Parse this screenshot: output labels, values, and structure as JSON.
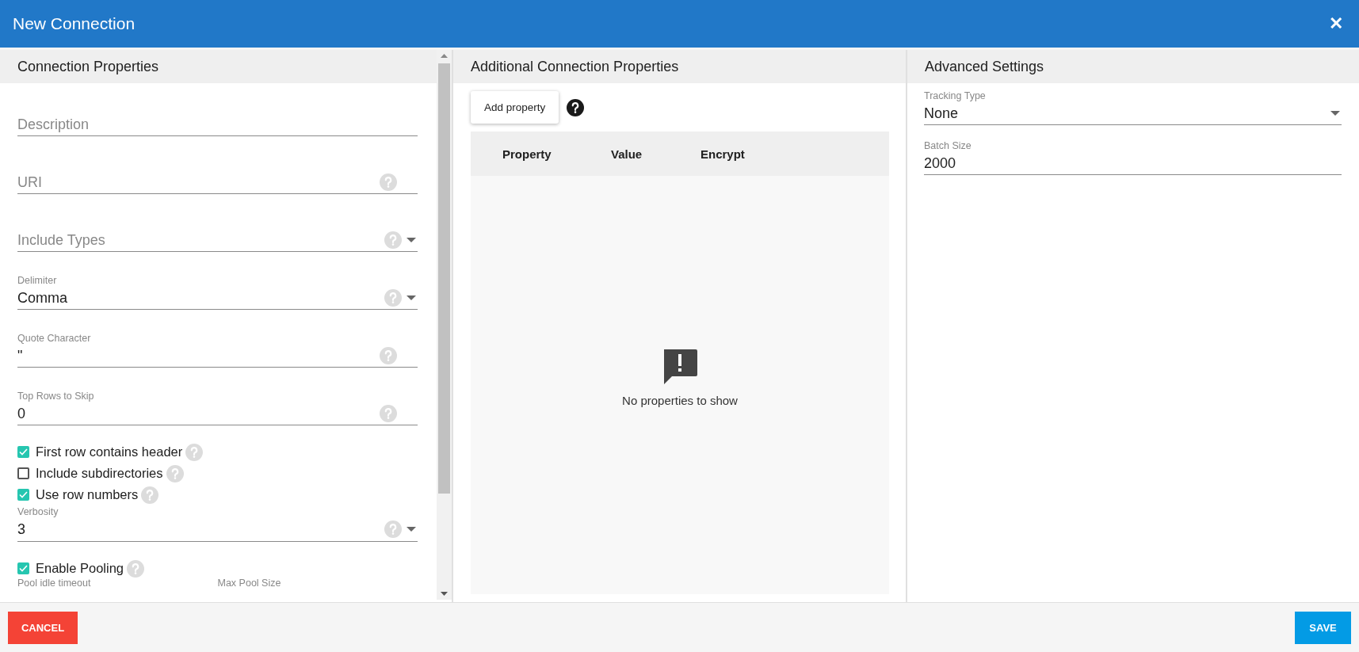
{
  "window": {
    "title": "New Connection",
    "close": "✕"
  },
  "connection_properties": {
    "title": "Connection Properties",
    "items": [
      {
        "kind": "field",
        "placeholder": "Description",
        "help": false,
        "dropdown": false
      },
      {
        "kind": "field",
        "placeholder": "URI",
        "help": true,
        "dropdown": false
      },
      {
        "kind": "field",
        "placeholder": "Include Types",
        "help": true,
        "dropdown": true
      },
      {
        "kind": "field",
        "label": "Delimiter",
        "value": "Comma",
        "help": true,
        "dropdown": true
      },
      {
        "kind": "field",
        "label": "Quote Character",
        "value": "\"",
        "help": true,
        "dropdown": false
      },
      {
        "kind": "field",
        "label": "Top Rows to Skip",
        "value": "0",
        "help": true,
        "dropdown": false
      },
      {
        "kind": "checkbox",
        "label": "First row contains header",
        "checked": true,
        "help": true
      },
      {
        "kind": "checkbox",
        "label": "Include subdirectories",
        "checked": false,
        "help": true
      },
      {
        "kind": "checkbox",
        "label": "Use row numbers",
        "checked": true,
        "help": true
      },
      {
        "kind": "field",
        "label": "Verbosity",
        "value": "3",
        "help": true,
        "dropdown": true
      },
      {
        "kind": "checkbox",
        "label": "Enable Pooling",
        "checked": true,
        "help": true
      },
      {
        "kind": "labels",
        "labels": [
          "Pool idle timeout",
          "Max Pool Size"
        ]
      }
    ]
  },
  "additional_properties": {
    "title": "Additional Connection Properties",
    "add_button": "Add property",
    "columns": [
      "Property",
      "Value",
      "Encrypt"
    ],
    "empty_message": "No properties to show"
  },
  "advanced_settings": {
    "title": "Advanced Settings",
    "items": [
      {
        "kind": "field",
        "label": "Tracking Type",
        "value": "None",
        "help": false,
        "dropdown": true
      },
      {
        "kind": "field",
        "label": "Batch Size",
        "value": "2000",
        "help": false,
        "dropdown": false
      }
    ]
  },
  "footer": {
    "cancel": "CANCEL",
    "save": "SAVE"
  }
}
